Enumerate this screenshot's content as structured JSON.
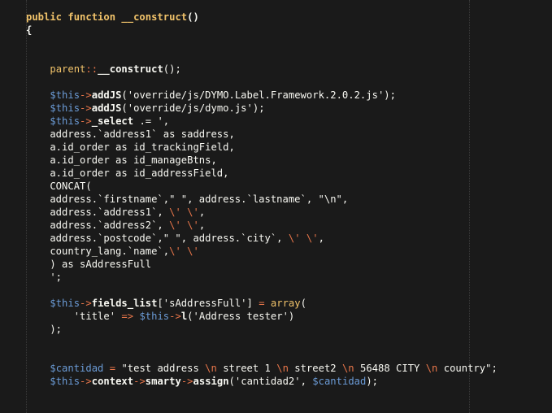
{
  "editor": {
    "theme_colors": {
      "background": "#1a1a1a",
      "keyword": "#f0c26a",
      "variable": "#6b9bd6",
      "operator": "#e8764a",
      "text": "#f8f8f2"
    },
    "lines": [
      [
        {
          "t": "public function ",
          "c": "kw bold"
        },
        {
          "t": "__construct",
          "c": "fn bold"
        },
        {
          "t": "()",
          "c": "plain bold"
        }
      ],
      [
        {
          "t": "{",
          "c": "plain bold"
        }
      ],
      [],
      [],
      [
        {
          "t": "    ",
          "c": "plain"
        },
        {
          "t": "parent",
          "c": "kw"
        },
        {
          "t": "::",
          "c": "op"
        },
        {
          "t": "__construct",
          "c": "plain bold"
        },
        {
          "t": "();",
          "c": "plain"
        }
      ],
      [],
      [
        {
          "t": "    ",
          "c": "plain"
        },
        {
          "t": "$this",
          "c": "var"
        },
        {
          "t": "->",
          "c": "op"
        },
        {
          "t": "addJS",
          "c": "plain bold"
        },
        {
          "t": "(",
          "c": "plain"
        },
        {
          "t": "'override/js/DYMO.Label.Framework.2.0.2.js'",
          "c": "str"
        },
        {
          "t": ");",
          "c": "plain"
        }
      ],
      [
        {
          "t": "    ",
          "c": "plain"
        },
        {
          "t": "$this",
          "c": "var"
        },
        {
          "t": "->",
          "c": "op"
        },
        {
          "t": "addJS",
          "c": "plain bold"
        },
        {
          "t": "(",
          "c": "plain"
        },
        {
          "t": "'override/js/dymo.js'",
          "c": "str"
        },
        {
          "t": ");",
          "c": "plain"
        }
      ],
      [
        {
          "t": "    ",
          "c": "plain"
        },
        {
          "t": "$this",
          "c": "var"
        },
        {
          "t": "->",
          "c": "op"
        },
        {
          "t": "_select",
          "c": "plain bold"
        },
        {
          "t": " .= ",
          "c": "plain"
        },
        {
          "t": "',",
          "c": "str"
        }
      ],
      [
        {
          "t": "    address.`address1` as saddress,",
          "c": "str"
        }
      ],
      [
        {
          "t": "    a.id_order as id_trackingField,",
          "c": "str"
        }
      ],
      [
        {
          "t": "    a.id_order as id_manageBtns,",
          "c": "str"
        }
      ],
      [
        {
          "t": "    a.id_order as id_addressField,",
          "c": "str"
        }
      ],
      [
        {
          "t": "    CONCAT(",
          "c": "str"
        }
      ],
      [
        {
          "t": "    address.`firstname`,\" \", address.`lastname`, \"\\n\",",
          "c": "str"
        }
      ],
      [
        {
          "t": "    address.`address1`, ",
          "c": "str"
        },
        {
          "t": "\\'",
          "c": "esc"
        },
        {
          "t": " ",
          "c": "str"
        },
        {
          "t": "\\'",
          "c": "esc"
        },
        {
          "t": ",",
          "c": "str"
        }
      ],
      [
        {
          "t": "    address.`address2`, ",
          "c": "str"
        },
        {
          "t": "\\'",
          "c": "esc"
        },
        {
          "t": " ",
          "c": "str"
        },
        {
          "t": "\\'",
          "c": "esc"
        },
        {
          "t": ",",
          "c": "str"
        }
      ],
      [
        {
          "t": "    address.`postcode`,\" \", address.`city`, ",
          "c": "str"
        },
        {
          "t": "\\'",
          "c": "esc"
        },
        {
          "t": " ",
          "c": "str"
        },
        {
          "t": "\\'",
          "c": "esc"
        },
        {
          "t": ",",
          "c": "str"
        }
      ],
      [
        {
          "t": "    country_lang.`name`,",
          "c": "str"
        },
        {
          "t": "\\'",
          "c": "esc"
        },
        {
          "t": " ",
          "c": "str"
        },
        {
          "t": "\\'",
          "c": "esc"
        }
      ],
      [
        {
          "t": "    ) as sAddressFull",
          "c": "str"
        }
      ],
      [
        {
          "t": "    ';",
          "c": "str"
        }
      ],
      [],
      [
        {
          "t": "    ",
          "c": "plain"
        },
        {
          "t": "$this",
          "c": "var"
        },
        {
          "t": "->",
          "c": "op"
        },
        {
          "t": "fields_list",
          "c": "plain bold"
        },
        {
          "t": "[",
          "c": "plain"
        },
        {
          "t": "'sAddressFull'",
          "c": "str"
        },
        {
          "t": "] ",
          "c": "plain"
        },
        {
          "t": "=",
          "c": "op"
        },
        {
          "t": " ",
          "c": "plain"
        },
        {
          "t": "array",
          "c": "kw"
        },
        {
          "t": "(",
          "c": "plain"
        }
      ],
      [
        {
          "t": "        ",
          "c": "plain"
        },
        {
          "t": "'title'",
          "c": "str"
        },
        {
          "t": " ",
          "c": "plain"
        },
        {
          "t": "=>",
          "c": "op"
        },
        {
          "t": " ",
          "c": "plain"
        },
        {
          "t": "$this",
          "c": "var"
        },
        {
          "t": "->",
          "c": "op"
        },
        {
          "t": "l",
          "c": "plain bold"
        },
        {
          "t": "(",
          "c": "plain"
        },
        {
          "t": "'Address tester'",
          "c": "str"
        },
        {
          "t": ")",
          "c": "plain"
        }
      ],
      [
        {
          "t": "    );",
          "c": "plain"
        }
      ],
      [],
      [],
      [
        {
          "t": "    ",
          "c": "plain"
        },
        {
          "t": "$cantidad",
          "c": "var"
        },
        {
          "t": " ",
          "c": "plain"
        },
        {
          "t": "=",
          "c": "op"
        },
        {
          "t": " ",
          "c": "plain"
        },
        {
          "t": "\"test address ",
          "c": "str"
        },
        {
          "t": "\\n",
          "c": "esc"
        },
        {
          "t": " street 1 ",
          "c": "str"
        },
        {
          "t": "\\n",
          "c": "esc"
        },
        {
          "t": " street2 ",
          "c": "str"
        },
        {
          "t": "\\n",
          "c": "esc"
        },
        {
          "t": " 56488 CITY ",
          "c": "str"
        },
        {
          "t": "\\n",
          "c": "esc"
        },
        {
          "t": " country\"",
          "c": "str"
        },
        {
          "t": ";",
          "c": "plain"
        }
      ],
      [
        {
          "t": "    ",
          "c": "plain"
        },
        {
          "t": "$this",
          "c": "var"
        },
        {
          "t": "->",
          "c": "op"
        },
        {
          "t": "context",
          "c": "plain bold"
        },
        {
          "t": "->",
          "c": "op"
        },
        {
          "t": "smarty",
          "c": "plain bold"
        },
        {
          "t": "->",
          "c": "op"
        },
        {
          "t": "assign",
          "c": "plain bold"
        },
        {
          "t": "(",
          "c": "plain"
        },
        {
          "t": "'cantidad2'",
          "c": "str"
        },
        {
          "t": ", ",
          "c": "plain"
        },
        {
          "t": "$cantidad",
          "c": "var"
        },
        {
          "t": ");",
          "c": "plain"
        }
      ]
    ]
  }
}
